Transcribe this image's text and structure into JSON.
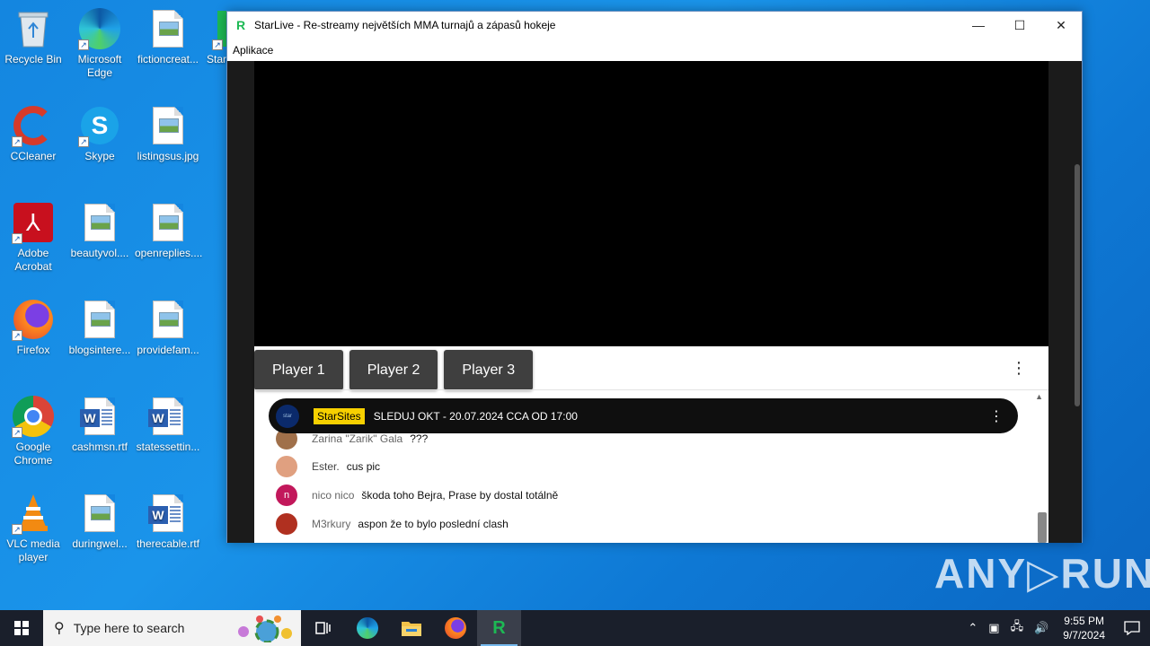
{
  "desktop": {
    "icons": [
      {
        "name": "recycle-bin",
        "label": "Recycle Bin"
      },
      {
        "name": "microsoft-edge",
        "label": "Microsoft Edge"
      },
      {
        "name": "fictioncreat",
        "label": "fictioncreat..."
      },
      {
        "name": "starlive",
        "label": "StarL"
      },
      {
        "name": "ccleaner",
        "label": "CCleaner"
      },
      {
        "name": "skype",
        "label": "Skype"
      },
      {
        "name": "listingsus",
        "label": "listingsus.jpg"
      },
      {
        "name": "adobe-acrobat",
        "label": "Adobe Acrobat"
      },
      {
        "name": "beautyvol",
        "label": "beautyvol...."
      },
      {
        "name": "openreplies",
        "label": "openreplies...."
      },
      {
        "name": "firefox",
        "label": "Firefox"
      },
      {
        "name": "blogsintere",
        "label": "blogsintere..."
      },
      {
        "name": "providefam",
        "label": "providefam..."
      },
      {
        "name": "google-chrome",
        "label": "Google Chrome"
      },
      {
        "name": "cashmsn",
        "label": "cashmsn.rtf"
      },
      {
        "name": "statessettin",
        "label": "statessettin..."
      },
      {
        "name": "vlc",
        "label": "VLC media player"
      },
      {
        "name": "duringwel",
        "label": "duringwel..."
      },
      {
        "name": "therecable",
        "label": "therecable.rtf"
      }
    ]
  },
  "window": {
    "title": "StarLive - Re-streamy největších MMA turnajů a zápasů hokeje",
    "menu": "Aplikace",
    "controls": {
      "minimize": "—",
      "maximize": "☐",
      "close": "✕"
    }
  },
  "players": [
    "Player 1",
    "Player 2",
    "Player 3"
  ],
  "chat": {
    "pinned": {
      "badge": "StarSites",
      "text": "SLEDUJ OKT - 20.07.2024 CCA OD 17:00"
    },
    "messages": [
      {
        "author": "Zarina \"Zarik\" Gala",
        "text": "???",
        "avatar_color": "#a0704a",
        "initial": ""
      },
      {
        "author": "Ester.",
        "text": "cus pic",
        "avatar_color": "#e0a080",
        "initial": ""
      },
      {
        "author": "nico nico",
        "text": "škoda toho Bejra, Prase by dostal totálně",
        "avatar_color": "#c2185b",
        "initial": "n"
      },
      {
        "author": "M3rkury",
        "text": "aspon že to bylo poslední clash",
        "avatar_color": "#b03020",
        "initial": ""
      }
    ]
  },
  "taskbar": {
    "search_placeholder": "Type here to search",
    "time": "9:55 PM",
    "date": "9/7/2024"
  },
  "watermark": "ANY▷RUN",
  "colors": {
    "accent": "#1db954",
    "badge": "#f7d000"
  }
}
